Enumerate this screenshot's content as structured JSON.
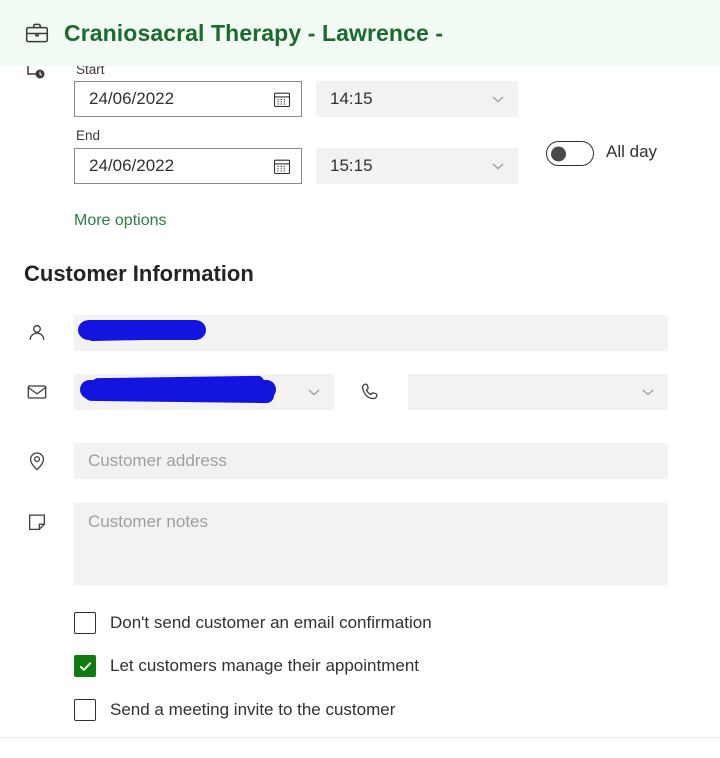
{
  "header": {
    "icon": "briefcase-icon",
    "title": "Craniosacral Therapy - Lawrence -",
    "background_color": "#F2FAF4",
    "title_color": "#1A6B2E"
  },
  "schedule": {
    "rail_icon": "clock-icon",
    "start_label": "Start",
    "start_date": "24/06/2022",
    "start_time": "14:15",
    "end_label": "End",
    "end_date": "24/06/2022",
    "end_time": "15:15",
    "calendar_icon": "calendar-icon",
    "chevron_icon": "chevron-down-icon",
    "all_day_label": "All day",
    "all_day_checked": false,
    "more_options_label": "More options",
    "more_options_color": "#2E7D3F"
  },
  "customer": {
    "section_title": "Customer Information",
    "name": {
      "icon": "person-icon",
      "value": "",
      "placeholder": "",
      "redacted": true
    },
    "email": {
      "icon": "mail-icon",
      "value": "",
      "placeholder": "",
      "redacted": true,
      "chevron_icon": "chevron-down-icon"
    },
    "phone": {
      "icon": "phone-icon",
      "value": "",
      "placeholder": "",
      "chevron_icon": "chevron-down-icon"
    },
    "address": {
      "icon": "location-pin-icon",
      "value": "",
      "placeholder": "Customer address"
    },
    "notes": {
      "icon": "note-icon",
      "value": "",
      "placeholder": "Customer notes"
    }
  },
  "options": {
    "items": [
      {
        "label": "Don't send customer an email confirmation",
        "checked": false
      },
      {
        "label": "Let customers manage their appointment",
        "checked": true
      },
      {
        "label": "Send a meeting invite to the customer",
        "checked": false
      }
    ],
    "checked_color": "#107C10"
  },
  "colors": {
    "input_background": "#F3F2F1",
    "redaction": "#1414E0",
    "divider": "#EDEBE9",
    "text": "#323130"
  }
}
